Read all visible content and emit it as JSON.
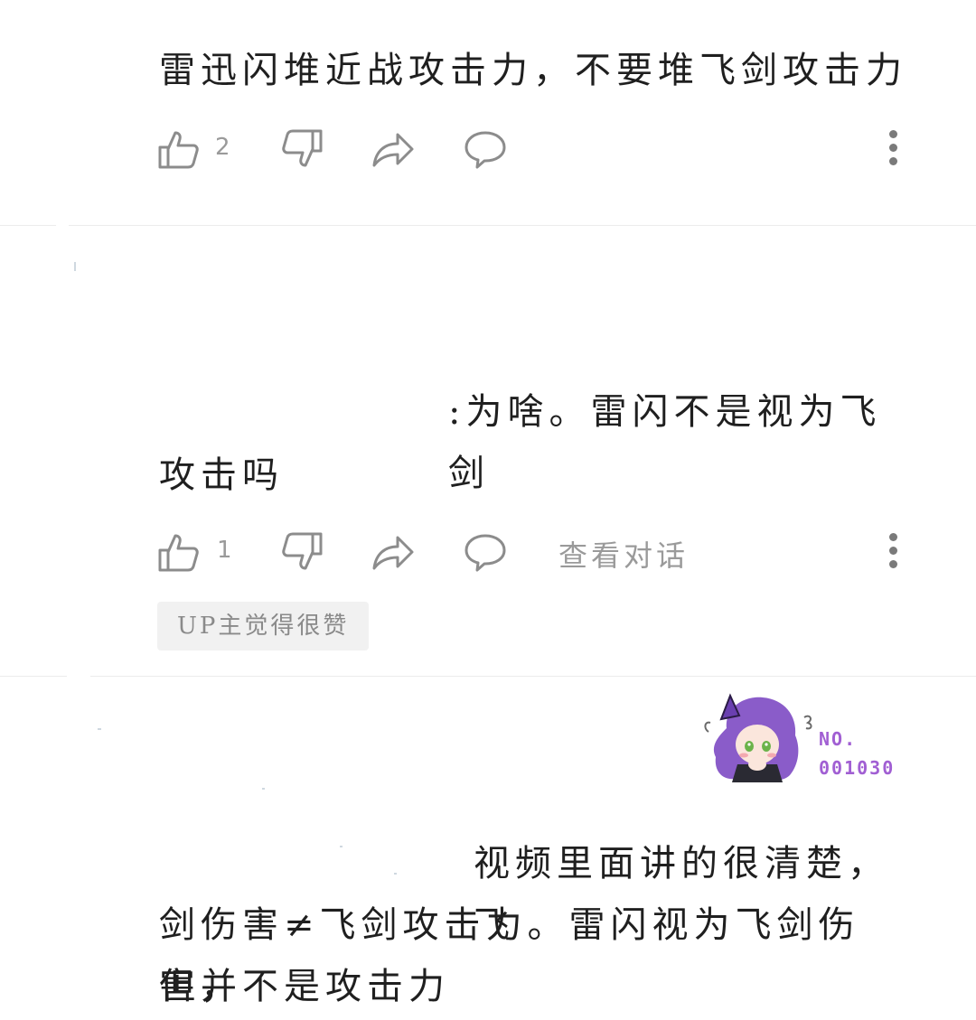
{
  "comments": [
    {
      "text": "雷迅闪堆近战攻击力，不要堆飞剑攻击力",
      "likes": "2"
    },
    {
      "text_line1": ":为啥。雷闪不是视为飞剑",
      "text_line2": "攻击吗",
      "likes": "1",
      "view_conversation": "查看对话",
      "up_badge": "UP主觉得很赞"
    },
    {
      "text_line1": "视频里面讲的很清楚，飞",
      "text_line2": "剑伤害≠飞剑攻击力。雷闪视为飞剑伤害，",
      "text_line3": "但并不是攻击力",
      "pendant": {
        "label": "NO.",
        "number": "001030",
        "accent_color": "#a15fd3"
      }
    }
  ],
  "icons": {
    "like": "thumbs-up-icon",
    "dislike": "thumbs-down-icon",
    "share": "share-arrow-icon",
    "reply": "speech-bubble-icon",
    "more": "more-vertical-icon"
  },
  "colors": {
    "text": "#1f1f1f",
    "muted": "#9a9a9a",
    "badge_bg": "#f1f1f1",
    "divider": "#ececec"
  }
}
